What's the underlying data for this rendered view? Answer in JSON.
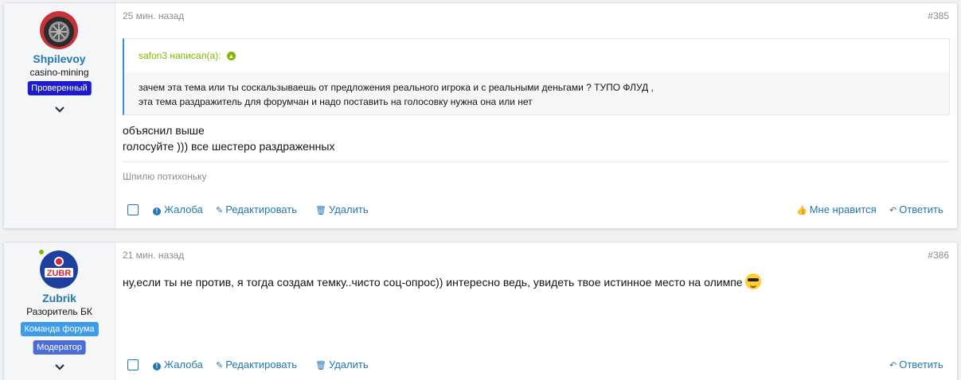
{
  "posts": [
    {
      "user": {
        "name": "Shpilevoy",
        "title": "casino-mining",
        "banners": [
          {
            "label": "Проверенный",
            "color": "#1c1ccc"
          }
        ],
        "online": false
      },
      "date": "25 мин. назад",
      "number": "#385",
      "quote": {
        "author": "safon3 написал(а):",
        "lines": [
          "зачем эта тема или ты соскальзываешь от предложения реального игрока и с реальными деньгами ? ТУПО ФЛУД ,",
          "эта тема раздражитель для форумчан и надо поставить на голосовку нужна она или нет"
        ]
      },
      "text_lines": [
        "объяснил выше",
        "голосуйте ))) все шестеро раздраженных"
      ],
      "signature": "Шпилю потихоньку",
      "actions": {
        "report": "Жалоба",
        "edit": "Редактировать",
        "delete": "Удалить",
        "like": "Мне нравится",
        "reply": "Ответить"
      }
    },
    {
      "user": {
        "name": "Zubrik",
        "title": "Разоритель БК",
        "banners": [
          {
            "label": "Команда форума",
            "color": "#3d9be9"
          },
          {
            "label": "Модератор",
            "color": "#4a6cd4"
          }
        ],
        "online": true,
        "avatar_text": "ZUBR"
      },
      "date": "21 мин. назад",
      "number": "#386",
      "text_lines": [
        "ну,если ты не против, я тогда создам темку..чисто соц-опрос)) интересно ведь, увидеть твое истинное место на олимпе"
      ],
      "actions": {
        "report": "Жалоба",
        "edit": "Редактировать",
        "delete": "Удалить",
        "reply": "Ответить"
      }
    }
  ],
  "colors": {
    "link": "#2577b1",
    "online": "#7fb900",
    "muted": "#8c8c8c"
  }
}
